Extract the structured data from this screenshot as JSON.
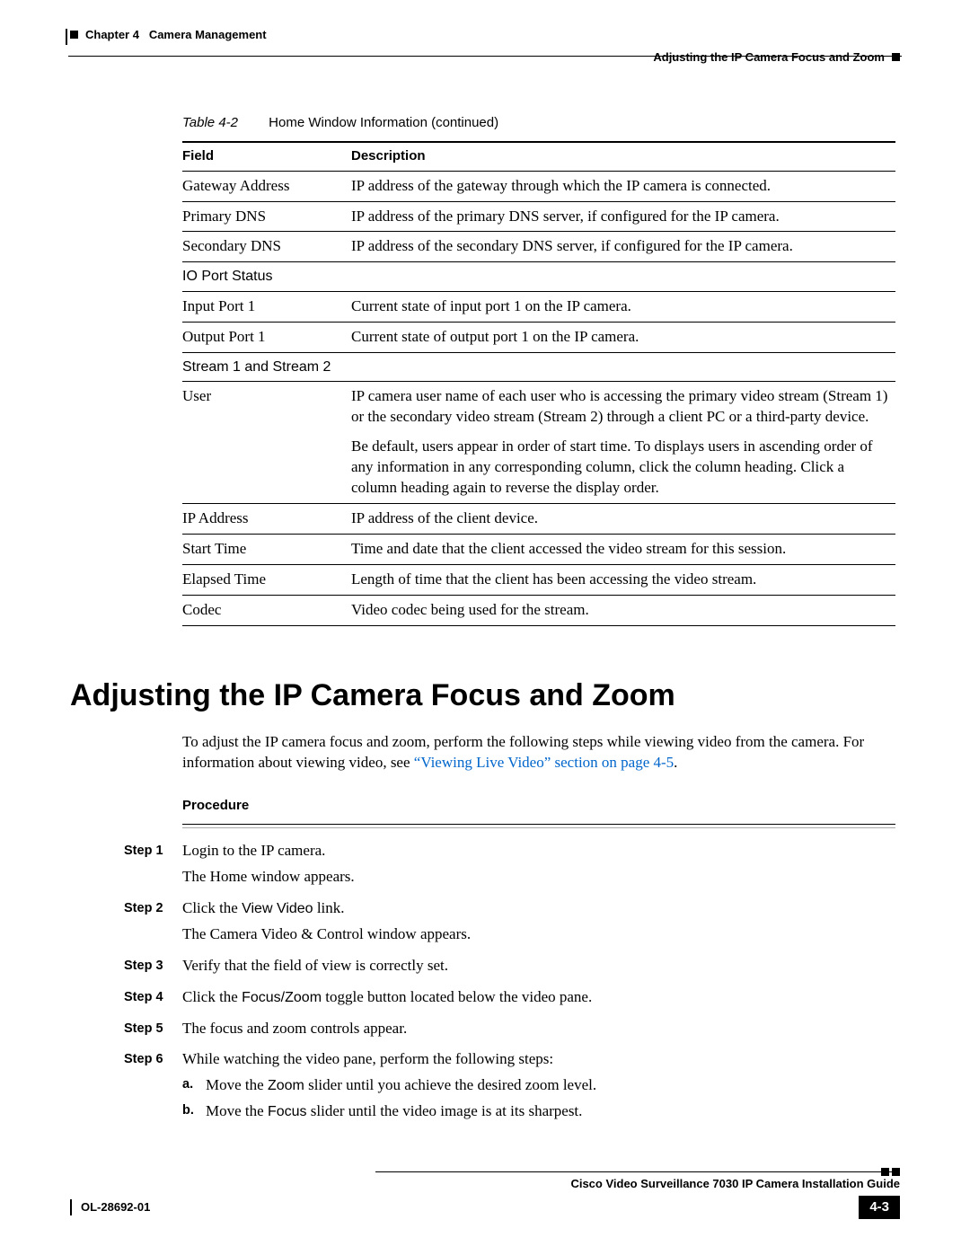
{
  "header": {
    "chapter_label": "Chapter 4",
    "chapter_title": "Camera Management",
    "section_running": "Adjusting the IP Camera Focus and Zoom"
  },
  "table": {
    "caption_label": "Table 4-2",
    "caption_title": "Home Window Information (continued)",
    "col_field": "Field",
    "col_desc": "Description",
    "rows": [
      {
        "field": "Gateway Address",
        "desc": "IP address of the gateway through which the IP camera is connected."
      },
      {
        "field": "Primary DNS",
        "desc": "IP address of the primary DNS server, if configured for the IP camera."
      },
      {
        "field": "Secondary DNS",
        "desc": "IP address of the secondary DNS server, if configured for the IP camera."
      }
    ],
    "section_io": "IO Port Status",
    "rows_io": [
      {
        "field": "Input Port 1",
        "desc": "Current state of input port 1 on the IP camera."
      },
      {
        "field": "Output Port 1",
        "desc": "Current state of output port 1 on the IP camera."
      }
    ],
    "section_stream": "Stream 1 and Stream 2",
    "user_field": "User",
    "user_p1": "IP camera user name of each user who is accessing the primary video stream (Stream 1) or the secondary video stream (Stream 2) through a client PC or a third-party device.",
    "user_p2": "Be default, users appear in order of start time. To displays users in ascending order of any information in any corresponding column, click the column heading. Click a column heading again to reverse the display order.",
    "rows_after": [
      {
        "field": "IP Address",
        "desc": "IP address of the client device."
      },
      {
        "field": "Start Time",
        "desc": "Time and date that the client accessed the video stream for this session."
      },
      {
        "field": "Elapsed Time",
        "desc": "Length of time that the client has been accessing the video stream."
      },
      {
        "field": "Codec",
        "desc": "Video codec being used for the stream."
      }
    ]
  },
  "section": {
    "title": "Adjusting the IP Camera Focus and Zoom",
    "intro_pre": "To adjust the IP camera focus and zoom, perform the following steps while viewing video from the camera. For information about viewing video, see ",
    "intro_link": "“Viewing Live Video” section on page 4-5",
    "intro_post": ".",
    "procedure_label": "Procedure"
  },
  "steps": {
    "labels": [
      "Step 1",
      "Step 2",
      "Step 3",
      "Step 4",
      "Step 5",
      "Step 6"
    ],
    "s1a": "Login to the IP camera.",
    "s1b": "The Home window appears.",
    "s2a_pre": "Click the ",
    "s2a_ui": "View Video",
    "s2a_post": " link.",
    "s2b": "The Camera Video & Control window appears.",
    "s3": "Verify that the field of view is correctly set.",
    "s4_pre": "Click the ",
    "s4_ui": "Focus/Zoom",
    "s4_post": " toggle button located below the video pane.",
    "s5": "The focus and zoom controls appear.",
    "s6_intro": "While watching the video pane, perform the following steps:",
    "sub_a_label": "a.",
    "sub_a_pre": "Move the ",
    "sub_a_ui": "Zoom",
    "sub_a_post": " slider until you achieve the desired zoom level.",
    "sub_b_label": "b.",
    "sub_b_pre": "Move the ",
    "sub_b_ui": "Focus",
    "sub_b_post": " slider until the video image is at its sharpest."
  },
  "footer": {
    "guide_title": "Cisco Video Surveillance 7030 IP Camera Installation Guide",
    "doc_id": "OL-28692-01",
    "page_num": "4-3"
  }
}
